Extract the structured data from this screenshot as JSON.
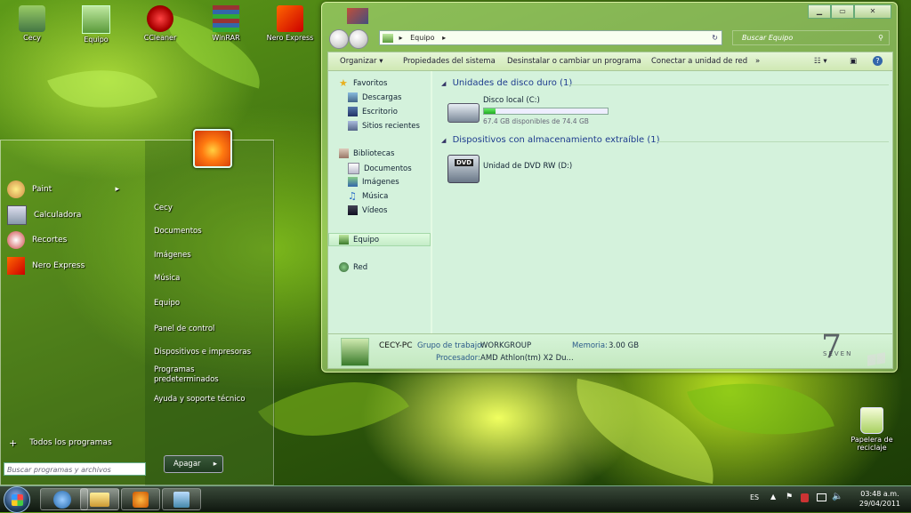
{
  "desktop": {
    "icons": [
      {
        "label": "Cecy"
      },
      {
        "label": "Equipo"
      },
      {
        "label": "CCleaner"
      },
      {
        "label": "WinRAR"
      },
      {
        "label": "Nero Express"
      }
    ],
    "recycle_bin": {
      "line1": "Papelera de",
      "line2": "reciclaje"
    }
  },
  "start_menu": {
    "programs": [
      {
        "label": "Paint",
        "has_submenu": true
      },
      {
        "label": "Calculadora"
      },
      {
        "label": "Recortes"
      },
      {
        "label": "Nero Express"
      }
    ],
    "all_programs": "Todos los programas",
    "search_placeholder": "Buscar programas y archivos",
    "right_links": [
      {
        "label": "Cecy"
      },
      {
        "label": "Documentos"
      },
      {
        "label": "Imágenes"
      },
      {
        "label": "Música"
      },
      {
        "label": "Equipo"
      },
      {
        "label": "Panel de control"
      },
      {
        "label": "Dispositivos e impresoras"
      },
      {
        "label": "Programas"
      },
      {
        "label": "predeterminados"
      },
      {
        "label": "Ayuda y soporte técnico"
      }
    ],
    "shutdown_label": "Apagar",
    "shutdown_arrow": "▸"
  },
  "explorer": {
    "caption_buttons": {
      "min": "▁",
      "max": "▭",
      "close": "✕"
    },
    "address": {
      "sep": "▸",
      "path": "Equipo",
      "arrow": "▸",
      "refresh": "↻"
    },
    "search_placeholder": "Buscar Equipo",
    "commands": [
      {
        "label": "Organizar ▾"
      },
      {
        "label": "Propiedades del sistema"
      },
      {
        "label": "Desinstalar o cambiar un programa"
      },
      {
        "label": "Conectar a unidad de red"
      },
      {
        "label": "»"
      }
    ],
    "nav": {
      "favoritos": "Favoritos",
      "descargas": "Descargas",
      "escritorio": "Escritorio",
      "sitios": "Sitios recientes",
      "bibliotecas": "Bibliotecas",
      "documentos": "Documentos",
      "imagenes": "Imágenes",
      "musica": "Música",
      "videos": "Vídeos",
      "equipo": "Equipo",
      "red": "Red"
    },
    "groups": {
      "hdd": "Unidades de disco duro (1)",
      "removable": "Dispositivos con almacenamiento extraíble (1)"
    },
    "drives": {
      "c_name": "Disco local (C:)",
      "c_free": "67.4 GB disponibles de 74.4 GB",
      "c_used_fraction": 0.094,
      "dvd_name": "Unidad de DVD RW (D:)",
      "dvd_badge": "DVD"
    },
    "details": {
      "pc_name": "CECY-PC",
      "workgroup_label": "Grupo de trabajo:",
      "workgroup": "WORKGROUP",
      "memory_label": "Memoria:",
      "memory": "3.00 GB",
      "cpu_label": "Procesador:",
      "cpu": "AMD Athlon(tm) X2 Du..."
    },
    "branding": {
      "number": "7",
      "text": "SEVEN"
    }
  },
  "taskbar": {
    "lang": "ES",
    "time": "03:48 a.m.",
    "date": "29/04/2011"
  },
  "colors": {
    "accent": "#1d3b8e",
    "progress": "#36c238"
  }
}
